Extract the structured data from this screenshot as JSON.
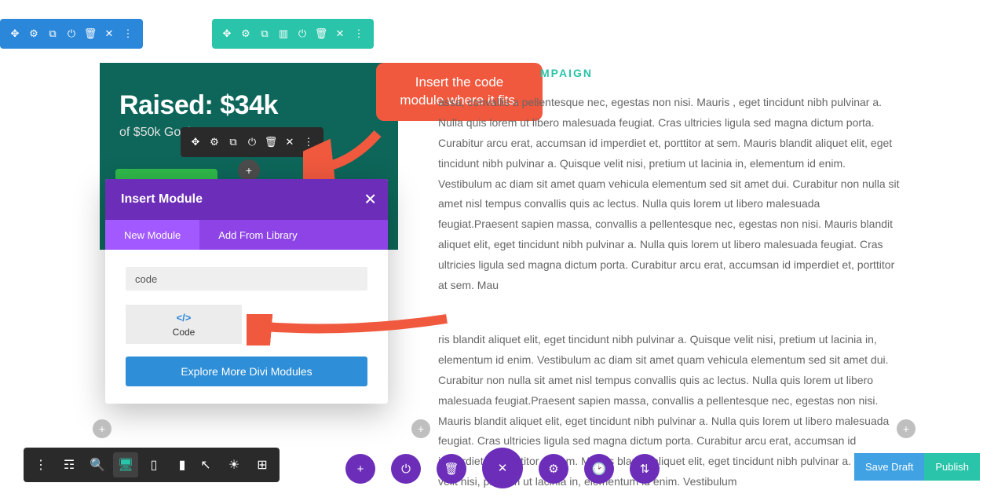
{
  "toolbars": {
    "icons": [
      "✥",
      "⚙",
      "⧉",
      "⟳",
      "♻",
      "✕",
      "⋮"
    ],
    "teal_icons": [
      "✥",
      "⚙",
      "⧉",
      "▭",
      "⟳",
      "♻",
      "✕",
      "⋮"
    ]
  },
  "raised": {
    "title": "Raised: $34k",
    "subtitle": "of $50k Goal"
  },
  "callout": {
    "line1": "Insert the code",
    "line2": "module where it fits."
  },
  "modal": {
    "title": "Insert Module",
    "tabs": [
      "New Module",
      "Add From Library"
    ],
    "search_value": "code",
    "module_label": "Code",
    "explore_label": "Explore More Divi Modules"
  },
  "heading_right": "MPAIGN",
  "body1": "assa, convallis a pellentesque nec, egestas non nisi. Mauris , eget tincidunt nibh pulvinar a. Nulla quis lorem ut libero malesuada feugiat. Cras ultricies ligula sed magna dictum porta. Curabitur arcu erat, accumsan id imperdiet et, porttitor at sem. Mauris blandit aliquet elit, eget tincidunt nibh pulvinar a. Quisque velit nisi, pretium ut lacinia in, elementum id enim. Vestibulum ac diam sit amet quam vehicula elementum sed sit amet dui. Curabitur non nulla sit amet nisl tempus convallis quis ac lectus. Nulla quis lorem ut libero malesuada feugiat.Praesent sapien massa, convallis a pellentesque nec, egestas non nisi. Mauris blandit aliquet elit, eget tincidunt nibh pulvinar a. Nulla quis lorem ut libero malesuada feugiat. Cras ultricies ligula sed magna dictum porta. Curabitur arcu erat, accumsan id imperdiet et, porttitor at sem. Mau",
  "body2": "ris blandit aliquet elit, eget tincidunt nibh pulvinar a. Quisque velit nisi, pretium ut lacinia in, elementum id enim. Vestibulum ac diam sit amet quam vehicula elementum sed sit amet dui. Curabitur non nulla sit amet nisl tempus convallis quis ac lectus. Nulla quis lorem ut libero malesuada feugiat.Praesent sapien massa, convallis a pellentesque nec, egestas non nisi. Mauris blandit aliquet elit, eget tincidunt nibh pulvinar a. Nulla quis lorem ut libero malesuada feugiat. Cras ultricies ligula sed magna dictum porta. Curabitur arcu erat, accumsan id imperdiet et, porttitor at sem. Mauris blandit aliquet elit, eget tincidunt nibh pulvinar a. Quisque velit nisi, pretium ut lacinia in, elementum id enim. Vestibulum",
  "bottom_bar": {
    "save_draft": "Save Draft",
    "publish": "Publish"
  }
}
